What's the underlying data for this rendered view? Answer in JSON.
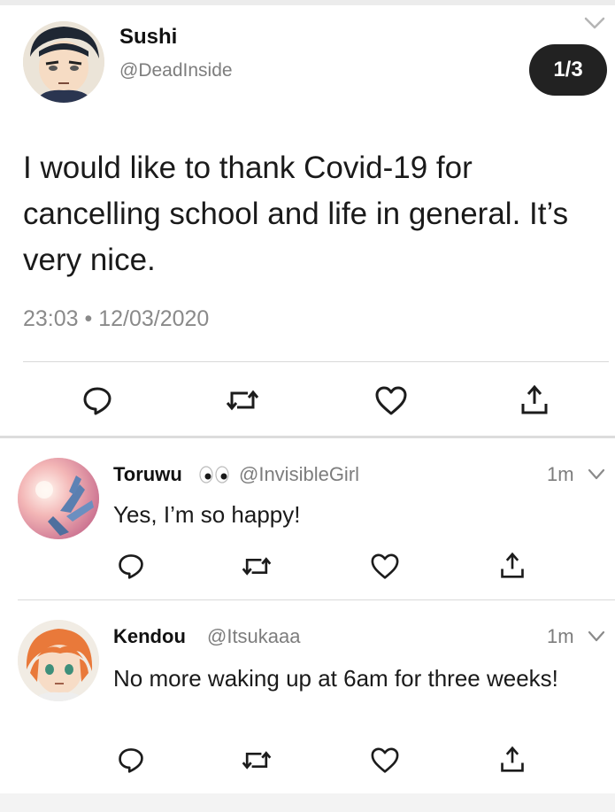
{
  "main_tweet": {
    "display_name": "Sushi",
    "handle": "@DeadInside",
    "counter": "1/3",
    "text": "I would like to thank Covid-19 for cancelling school and life in general. It’s very nice.",
    "meta": "23:03 • 12/03/2020"
  },
  "replies": [
    {
      "display_name": "Toruwu",
      "handle": "@InvisibleGirl",
      "time": "1m",
      "text": "Yes, I’m so happy!"
    },
    {
      "display_name": "Kendou",
      "handle": "@Itsukaaa",
      "time": "1m",
      "text": "No more waking up at 6am for three weeks!"
    }
  ],
  "icons": [
    "reply-icon",
    "retweet-icon",
    "like-icon",
    "share-icon",
    "chevron-down-icon",
    "eyes-emoji"
  ],
  "colors": {
    "icon": "#1c1c1c",
    "muted_text": "#7d7d7d",
    "divider": "#d9d9d9",
    "counter_bg": "#222222"
  }
}
